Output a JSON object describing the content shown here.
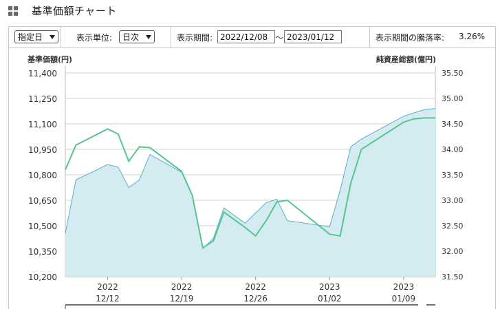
{
  "header": {
    "title": "基準価額チャート",
    "icon": "grid-icon"
  },
  "controls": {
    "range_select": "指定日",
    "unit_label": "表示単位:",
    "unit_select": "日次",
    "period_label": "表示期間:",
    "start_date": "2022/12/08",
    "separator": "～",
    "end_date": "2023/01/12",
    "change_label": "表示期間の騰落率:",
    "change_value": "3.26%"
  },
  "chart_data": {
    "type": "line",
    "left_axis_label": "基準価額(円)",
    "right_axis_label": "純資産総額(億円)",
    "y_left": {
      "min": 10200,
      "max": 11400,
      "ticks": [
        "11,400",
        "11,250",
        "11,100",
        "10,950",
        "10,800",
        "10,650",
        "10,500",
        "10,350",
        "10,200"
      ]
    },
    "y_right": {
      "min": 31.5,
      "max": 35.5,
      "ticks": [
        "35.50",
        "35.00",
        "34.50",
        "34.00",
        "33.50",
        "33.00",
        "32.50",
        "32.00",
        "31.50"
      ]
    },
    "x_ticks": [
      {
        "year": "2022",
        "date": "12/12",
        "day": 4
      },
      {
        "year": "2022",
        "date": "12/19",
        "day": 11
      },
      {
        "year": "2022",
        "date": "12/26",
        "day": 18
      },
      {
        "year": "2023",
        "date": "01/02",
        "day": 25
      },
      {
        "year": "2023",
        "date": "01/09",
        "day": 32
      }
    ],
    "x_range": [
      0,
      35
    ],
    "nav_series": {
      "color": "#55c68e",
      "days": [
        0,
        1,
        4,
        5,
        6,
        7,
        8,
        11,
        12,
        13,
        14,
        15,
        17,
        18,
        19,
        20,
        21,
        25,
        26,
        27,
        28,
        32,
        33,
        34,
        35
      ],
      "values": [
        10830,
        10975,
        11070,
        11040,
        10880,
        10965,
        10960,
        10820,
        10680,
        10370,
        10410,
        10580,
        10490,
        10440,
        10530,
        10640,
        10650,
        10450,
        10440,
        10750,
        10950,
        11110,
        11130,
        11135,
        11135
      ]
    },
    "aum_series": {
      "color": "#5aafc7",
      "fill": "#d3ebf1",
      "days": [
        0,
        1,
        4,
        5,
        6,
        7,
        8,
        11,
        12,
        13,
        14,
        15,
        17,
        18,
        19,
        20,
        21,
        25,
        26,
        27,
        28,
        32,
        33,
        34,
        35
      ],
      "values": [
        32.35,
        33.4,
        33.7,
        33.65,
        33.25,
        33.4,
        33.9,
        33.55,
        33.1,
        32.05,
        32.25,
        32.85,
        32.55,
        32.75,
        32.95,
        33.02,
        32.6,
        32.48,
        33.2,
        34.05,
        34.2,
        34.65,
        34.72,
        34.78,
        34.8
      ]
    }
  }
}
